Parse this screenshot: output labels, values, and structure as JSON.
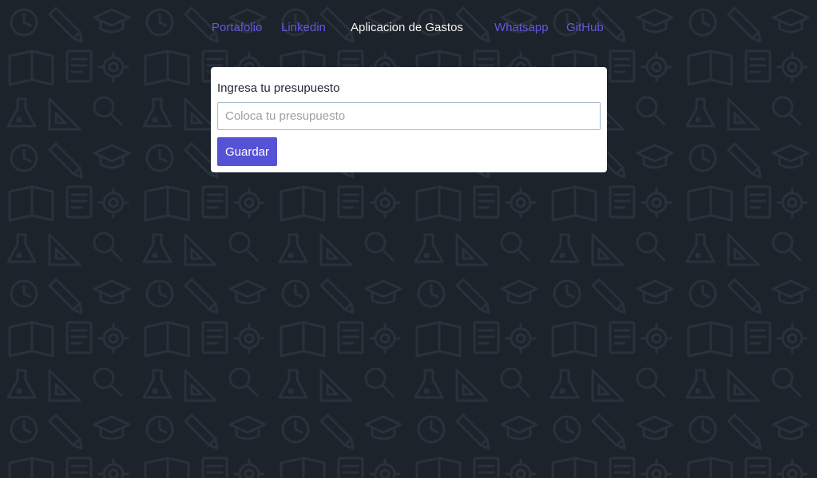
{
  "nav": {
    "items": [
      {
        "label": "Portafolio"
      },
      {
        "label": "Linkedin"
      },
      {
        "label": "Whatsapp"
      },
      {
        "label": "GitHub"
      }
    ],
    "title": "Aplicacion de Gastos"
  },
  "budget_form": {
    "label": "Ingresa tu presupuesto",
    "input_value": "",
    "input_placeholder": "Coloca tu presupuesto",
    "submit_label": "Guardar"
  },
  "colors": {
    "background": "#1d232b",
    "link": "#6159e0",
    "button": "#5552d6"
  },
  "background_icons": [
    "clock-icon",
    "pencil-icon",
    "graduation-cap-icon",
    "book-icon",
    "document-icon",
    "gear-icon",
    "flask-icon",
    "set-square-icon",
    "magnifier-icon"
  ]
}
